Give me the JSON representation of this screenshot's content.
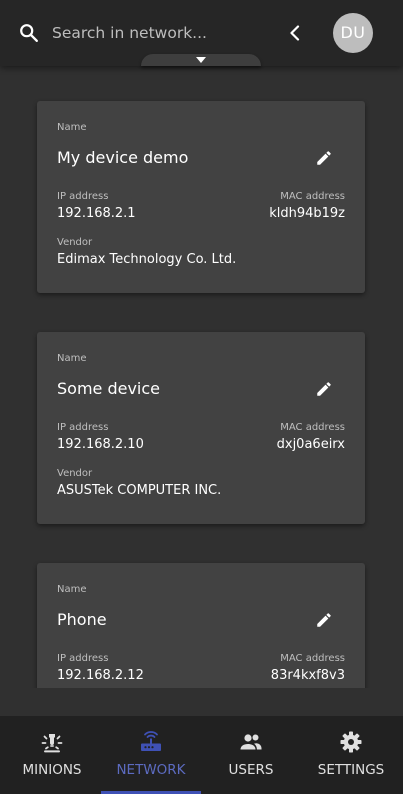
{
  "header": {
    "search_placeholder": "Search in network...",
    "search_value": "",
    "back_icon": "chevron-left-icon",
    "avatar_initials": "DU"
  },
  "labels": {
    "name": "Name",
    "ip": "IP address",
    "mac": "MAC address",
    "vendor": "Vendor"
  },
  "devices": [
    {
      "name": "My device demo",
      "ip": "192.168.2.1",
      "mac": "kldh94b19z",
      "vendor": "Edimax Technology Co. Ltd."
    },
    {
      "name": "Some device",
      "ip": "192.168.2.10",
      "mac": "dxj0a6eirx",
      "vendor": "ASUSTek COMPUTER INC."
    },
    {
      "name": "Phone",
      "ip": "192.168.2.12",
      "mac": "83r4kxf8v3",
      "vendor": ""
    }
  ],
  "nav": {
    "items": [
      {
        "label": "MINIONS",
        "icon": "lightbulb-icon",
        "active": false
      },
      {
        "label": "NETWORK",
        "icon": "router-icon",
        "active": true
      },
      {
        "label": "USERS",
        "icon": "users-icon",
        "active": false
      },
      {
        "label": "SETTINGS",
        "icon": "gear-icon",
        "active": false
      }
    ]
  },
  "colors": {
    "background": "#303030",
    "header": "#262626",
    "card": "#424242",
    "bottom_nav": "#212121",
    "accent": "#3f51b5",
    "accent_text": "#5c6bc0"
  }
}
